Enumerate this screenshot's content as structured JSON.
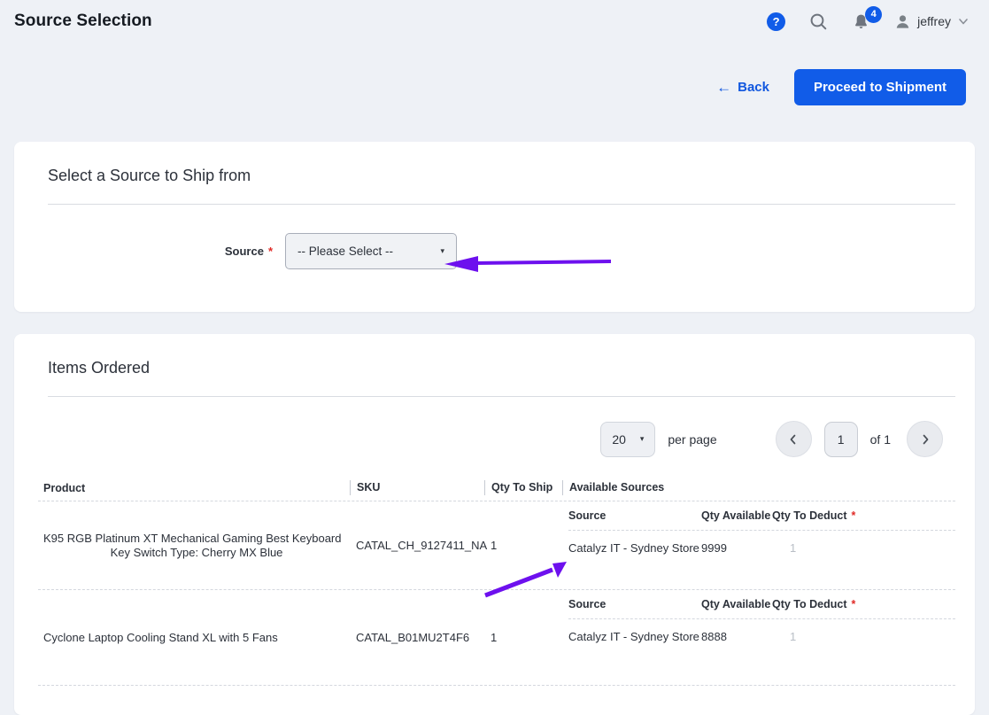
{
  "topbar": {
    "title": "Source Selection",
    "help_glyph": "?",
    "notification_count": "4",
    "user_name": "jeffrey"
  },
  "actions": {
    "back_arrow": "←",
    "back_label": "Back",
    "proceed_label": "Proceed to Shipment"
  },
  "source_card": {
    "title": "Select a Source to Ship from",
    "field_label": "Source",
    "required_marker": "*",
    "select_value": "-- Please Select --",
    "select_caret": "▾"
  },
  "items_card": {
    "title": "Items Ordered",
    "pagination": {
      "page_size": "20",
      "select_caret": "▾",
      "per_page_label": "per page",
      "current_page": "1",
      "of_label": "of 1"
    },
    "columns": {
      "product": "Product",
      "sku": "SKU",
      "qty_to_ship": "Qty To Ship",
      "available_sources": "Available Sources"
    },
    "source_columns": {
      "source": "Source",
      "qty_available": "Qty Available",
      "qty_to_deduct": "Qty To Deduct",
      "required_marker": "*"
    },
    "rows": [
      {
        "product_name": "K95 RGB Platinum XT Mechanical Gaming Best Keyboard",
        "product_option": "Key Switch Type: Cherry MX Blue",
        "sku": "CATAL_CH_9127411_NA",
        "qty_to_ship": "1",
        "source_name": "Catalyz IT - Sydney Store",
        "qty_available": "9999",
        "qty_to_deduct_placeholder": "1"
      },
      {
        "product_name": "Cyclone Laptop Cooling Stand XL with 5 Fans",
        "sku": "CATAL_B01MU2T4F6",
        "qty_to_ship": "1",
        "source_name": "Catalyz IT - Sydney Store",
        "qty_available": "8888",
        "qty_to_deduct_placeholder": "1"
      }
    ]
  },
  "colors": {
    "accent_blue": "#115ce8",
    "annotation_purple": "#6d10ee",
    "page_background": "#eef1f6",
    "required_red": "#e02b27"
  }
}
